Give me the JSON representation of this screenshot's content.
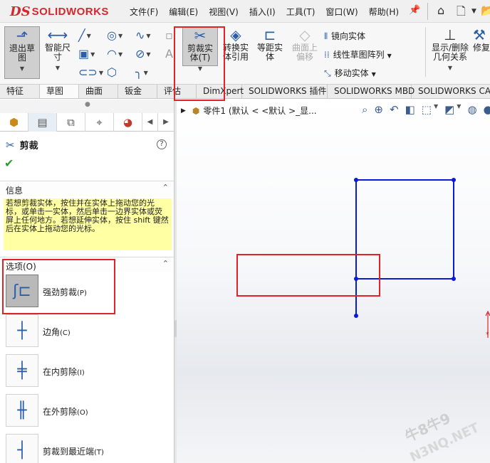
{
  "app": {
    "logo_ds": "DS",
    "logo_text": "SOLIDWORKS"
  },
  "menu": [
    {
      "label": "文件(F)"
    },
    {
      "label": "编辑(E)"
    },
    {
      "label": "视图(V)"
    },
    {
      "label": "插入(I)"
    },
    {
      "label": "工具(T)"
    },
    {
      "label": "窗口(W)"
    },
    {
      "label": "帮助(H)"
    }
  ],
  "ribbon": {
    "exit_sketch": "退出草\n图",
    "smart_dim": "智能尺\n寸",
    "trim": "剪裁实\n体(T)",
    "convert": "转换实\n体引用",
    "offset": "等距实\n体",
    "offset_surface": "曲面上\n偏移",
    "mirror": "镜向实体",
    "linear_pattern": "线性草图阵列",
    "move": "移动实体",
    "display_rel": "显示/删除\n几何关系",
    "repair": "修复"
  },
  "tabs": [
    "特征",
    "草图",
    "曲面",
    "钣金",
    "评估",
    "DimXpert",
    "SOLIDWORKS 插件",
    "SOLIDWORKS MBD",
    "SOLIDWORKS CAM"
  ],
  "panel": {
    "title": "剪裁",
    "info_header": "信息",
    "info_text": "若想剪裁实体，按住并在实体上拖动您的光标，或单击一实体，然后单击一边界实体或荧屏上任何地方。若想延伸实体，按住 shift 键然后在实体上拖动您的光标。",
    "options_header": "选项(O)",
    "options": [
      {
        "label": "强劲剪裁",
        "key": "(P)"
      },
      {
        "label": "边角",
        "key": "(C)"
      },
      {
        "label": "在内剪除",
        "key": "(I)"
      },
      {
        "label": "在外剪除",
        "key": "(O)"
      },
      {
        "label": "剪裁到最近端",
        "key": "(T)"
      }
    ]
  },
  "tree": {
    "text": "零件1  (默认 < <默认 >_显..."
  },
  "watermark": {
    "line1": "牛8牛9",
    "line2": "N3NQ.NET"
  },
  "colors": {
    "sketch": "#0a1ad6",
    "highlight": "#e0232b",
    "info_bg": "#ffffa3"
  }
}
